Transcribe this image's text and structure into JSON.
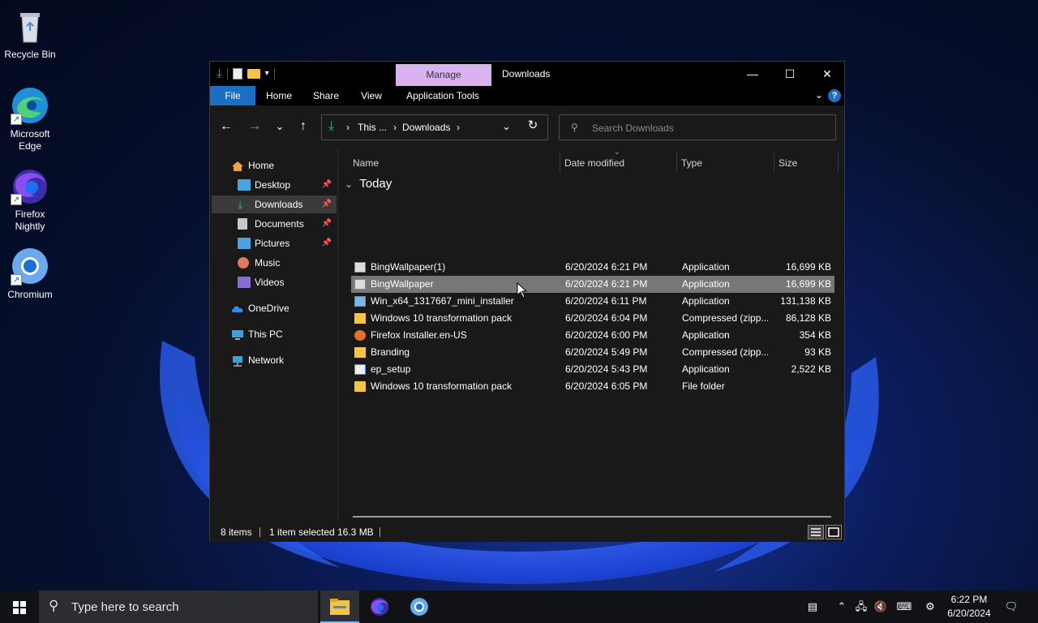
{
  "desktop": {
    "icons": [
      {
        "label": "Recycle Bin"
      },
      {
        "label": "Microsoft Edge"
      },
      {
        "label": "Firefox Nightly"
      },
      {
        "label": "Chromium"
      }
    ]
  },
  "window": {
    "title": "Downloads",
    "context_tab": "Manage",
    "ribbon_tabs": [
      "File",
      "Home",
      "Share",
      "View",
      "Application Tools"
    ],
    "controls": {
      "minimize": "—",
      "maximize": "☐",
      "close": "✕"
    },
    "help": "?"
  },
  "navbar": {
    "back": "←",
    "forward": "→",
    "recent": "⌄",
    "up": "↑",
    "breadcrumb": [
      "This ...",
      "Downloads"
    ],
    "refresh": "↻",
    "search_placeholder": "Search Downloads"
  },
  "nav_pane": {
    "items": [
      {
        "label": "Home"
      },
      {
        "label": "Desktop"
      },
      {
        "label": "Downloads"
      },
      {
        "label": "Documents"
      },
      {
        "label": "Pictures"
      },
      {
        "label": "Music"
      },
      {
        "label": "Videos"
      },
      {
        "label": "OneDrive"
      },
      {
        "label": "This PC"
      },
      {
        "label": "Network"
      }
    ]
  },
  "file_list": {
    "columns": [
      "Name",
      "Date modified",
      "Type",
      "Size"
    ],
    "group": "Today",
    "rows": [
      {
        "name": "BingWallpaper(1)",
        "date": "6/20/2024 6:21 PM",
        "type": "Application",
        "size": "16,699 KB"
      },
      {
        "name": "BingWallpaper",
        "date": "6/20/2024 6:21 PM",
        "type": "Application",
        "size": "16,699 KB"
      },
      {
        "name": "Win_x64_1317667_mini_installer",
        "date": "6/20/2024 6:11 PM",
        "type": "Application",
        "size": "131,138 KB"
      },
      {
        "name": "Windows 10 transformation pack",
        "date": "6/20/2024 6:04 PM",
        "type": "Compressed (zipp...",
        "size": "86,128 KB"
      },
      {
        "name": "Firefox Installer.en-US",
        "date": "6/20/2024 6:00 PM",
        "type": "Application",
        "size": "354 KB"
      },
      {
        "name": "Branding",
        "date": "6/20/2024 5:49 PM",
        "type": "Compressed (zipp...",
        "size": "93 KB"
      },
      {
        "name": "ep_setup",
        "date": "6/20/2024 5:43 PM",
        "type": "Application",
        "size": "2,522 KB"
      },
      {
        "name": "Windows 10 transformation pack",
        "date": "6/20/2024 6:05 PM",
        "type": "File folder",
        "size": ""
      }
    ]
  },
  "status": {
    "count": "8 items",
    "selection": "1 item selected",
    "size": "16.3 MB"
  },
  "taskbar": {
    "search_placeholder": "Type here to search",
    "time": "6:22 PM",
    "date": "6/20/2024"
  },
  "colors": {
    "accent": "#1a6fc4",
    "manage_tab": "#d9b3f0",
    "selection": "#777777"
  }
}
